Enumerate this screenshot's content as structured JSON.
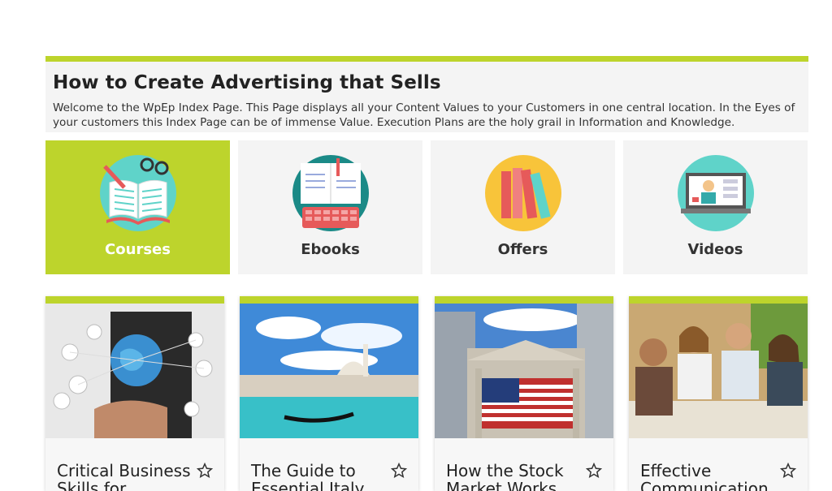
{
  "header": {
    "title": "How to Create Advertising that Sells",
    "description": "Welcome to the WpEp Index Page. This Page displays all your Content Values to your Customers in one central location. In the Eyes of your customers this Index Page can be of immense Value. Execution Plans are the holy grail in Information and Knowledge."
  },
  "categories": [
    {
      "label": "Courses",
      "icon": "open-book-icon",
      "active": true
    },
    {
      "label": "Ebooks",
      "icon": "ebook-reader-icon",
      "active": false
    },
    {
      "label": "Offers",
      "icon": "books-icon",
      "active": false
    },
    {
      "label": "Videos",
      "icon": "video-lesson-icon",
      "active": false
    }
  ],
  "cards": [
    {
      "title": "Critical Business Skills for",
      "image": "businessman-globe-network"
    },
    {
      "title": "The Guide to Essential Italy",
      "image": "venice-gondola"
    },
    {
      "title": "How the Stock Market Works",
      "image": "stock-exchange-flag"
    },
    {
      "title": "Effective Communication",
      "image": "friends-talking-cafe"
    }
  ],
  "colors": {
    "accent": "#bdd42c",
    "panel": "#f4f4f4"
  }
}
